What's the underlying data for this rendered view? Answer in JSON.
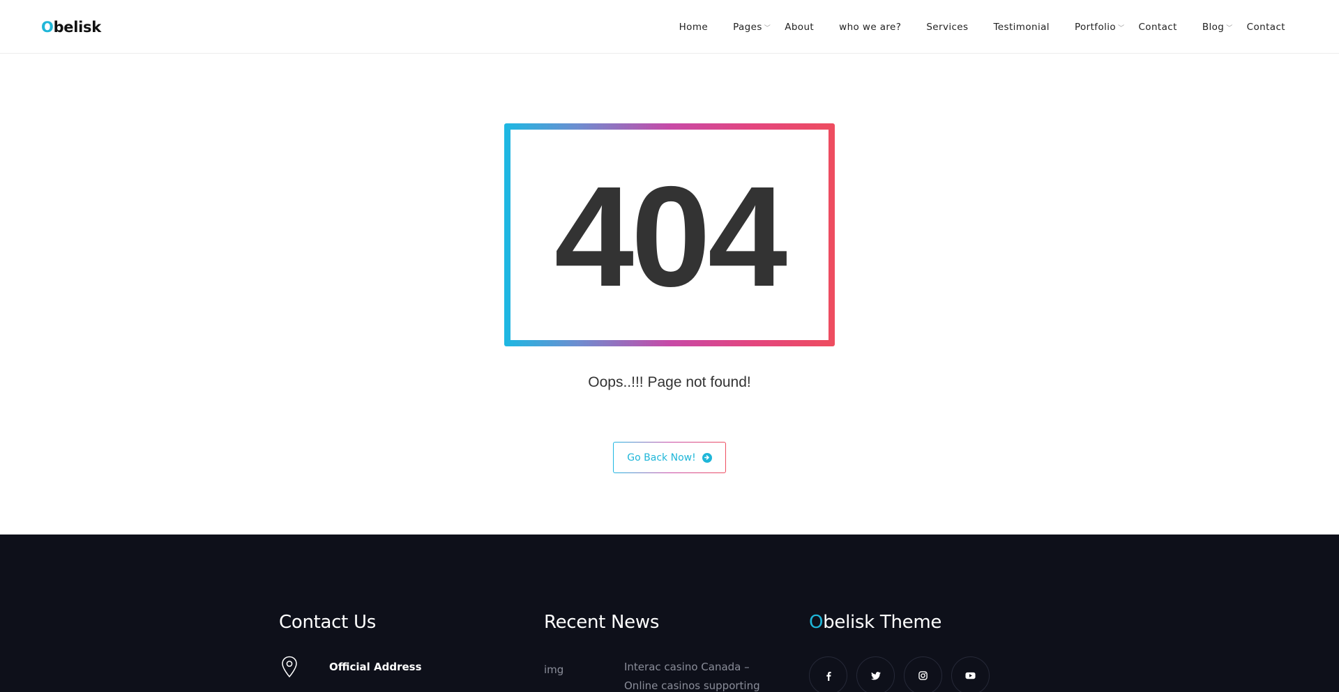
{
  "brand": {
    "logo_first": "O",
    "logo_rest": "belisk",
    "accent_color": "#1fb6d8"
  },
  "nav": {
    "items": [
      {
        "label": "Home",
        "has_dropdown": false
      },
      {
        "label": "Pages",
        "has_dropdown": true
      },
      {
        "label": "About",
        "has_dropdown": false
      },
      {
        "label": "who we are?",
        "has_dropdown": false
      },
      {
        "label": "Services",
        "has_dropdown": false
      },
      {
        "label": "Testimonial",
        "has_dropdown": false
      },
      {
        "label": "Portfolio",
        "has_dropdown": true
      },
      {
        "label": "Contact",
        "has_dropdown": false
      },
      {
        "label": "Blog",
        "has_dropdown": true
      },
      {
        "label": "Contact",
        "has_dropdown": false
      }
    ],
    "chevron": "﹀"
  },
  "error": {
    "code": "404",
    "message": "Oops..!!! Page not found!",
    "button_label": "Go Back Now!",
    "button_icon": "arrow-circle-right-icon",
    "gradient_colors": [
      "#1cb8e2",
      "#c74aa7",
      "#ee4d5f"
    ]
  },
  "footer": {
    "background": "#0e101a",
    "contact": {
      "title": "Contact Us",
      "address_label": "Official Address",
      "icon": "map-pin-icon"
    },
    "news": {
      "title": "Recent News",
      "image_alt": "img",
      "item_text": "Interac casino Canada – Online casinos supporting"
    },
    "theme": {
      "title_first": "O",
      "title_rest": "belisk Theme",
      "socials": [
        "facebook-icon",
        "twitter-icon",
        "instagram-icon",
        "youtube-icon"
      ]
    }
  }
}
